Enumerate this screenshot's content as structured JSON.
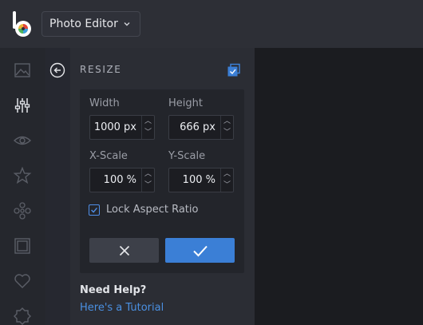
{
  "app": {
    "title": "Photo Editor"
  },
  "panel": {
    "title": "RESIZE",
    "width": {
      "label": "Width",
      "value": "1000",
      "unit": "px"
    },
    "height": {
      "label": "Height",
      "value": "666",
      "unit": "px"
    },
    "xscale": {
      "label": "X-Scale",
      "value": "100",
      "unit": "%"
    },
    "yscale": {
      "label": "Y-Scale",
      "value": "100",
      "unit": "%"
    },
    "lock": {
      "label": "Lock Aspect Ratio",
      "checked": true
    }
  },
  "help": {
    "title": "Need Help?",
    "link": "Here's a Tutorial"
  },
  "colors": {
    "accent": "#3b7fd6",
    "link": "#4a90e2"
  },
  "icons": [
    "image-icon",
    "sliders-icon",
    "eye-icon",
    "star-icon",
    "flower-icon",
    "frame-icon",
    "heart-icon",
    "badge-icon"
  ]
}
